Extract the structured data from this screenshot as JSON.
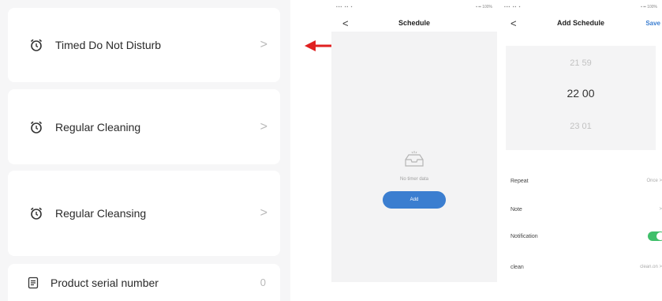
{
  "settings": {
    "items": [
      {
        "label": "Timed Do Not Disturb",
        "icon": "alarm-clock-icon",
        "chevron": ">"
      },
      {
        "label": "Regular Cleaning",
        "icon": "alarm-clock-icon",
        "chevron": ">"
      },
      {
        "label": "Regular Cleansing",
        "icon": "alarm-clock-icon",
        "chevron": ">"
      },
      {
        "label": "Product serial number",
        "icon": "document-icon",
        "value": "0"
      }
    ]
  },
  "arrow": {
    "color": "#e02020"
  },
  "phone1": {
    "status_left": "▪▪▪ ▪▪ ▪",
    "status_right": "▪ ▪▪ 100%",
    "back": "<",
    "title": "Schedule",
    "empty_text": "No timer data",
    "add_button": "Add"
  },
  "phone2": {
    "status_left": "▪▪▪ ▪▪ ▪",
    "status_right": "▪ ▪▪ 100%",
    "back": "<",
    "title": "Add Schedule",
    "save": "Save",
    "picker": {
      "prev": "21  59",
      "selected": "22  00",
      "next": "23  01"
    },
    "rows": [
      {
        "label": "Repeat",
        "value": "Once >"
      },
      {
        "label": "Note",
        "value": ">"
      },
      {
        "label": "Notification",
        "toggle": true
      },
      {
        "label": "clean",
        "value": "clean.on >"
      }
    ]
  },
  "colors": {
    "accent": "#3b7ed0",
    "toggle_on": "#3fbf6a"
  }
}
